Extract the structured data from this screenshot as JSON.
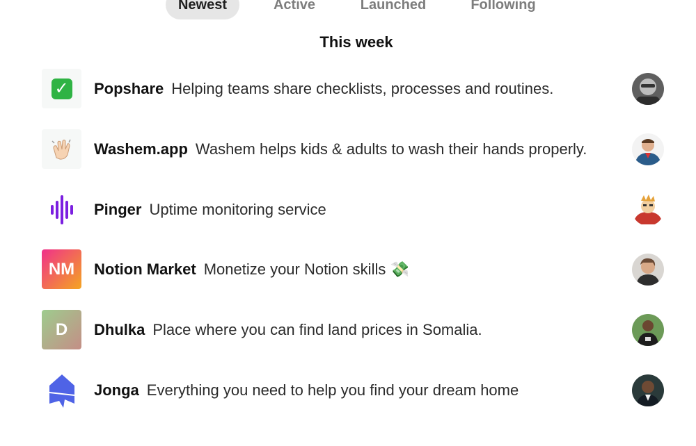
{
  "tabs": [
    {
      "label": "Newest",
      "active": true
    },
    {
      "label": "Active",
      "active": false
    },
    {
      "label": "Launched",
      "active": false
    },
    {
      "label": "Following",
      "active": false
    }
  ],
  "section": {
    "title": "This week"
  },
  "products": [
    {
      "name": "Popshare",
      "tagline": "Helping teams share checklists, processes and routines.",
      "icon": "checkmark-icon",
      "avatar_color": "#6f6f6f"
    },
    {
      "name": "Washem.app",
      "tagline": "Washem helps kids & adults to wash their hands properly.",
      "icon": "clapping-hands-icon",
      "avatar_color": "#2b5c8a"
    },
    {
      "name": "Pinger",
      "tagline": "Uptime monitoring service",
      "icon": "soundwave-icon",
      "avatar_color": "#c8382e"
    },
    {
      "name": "Notion Market",
      "tagline": "Monetize your Notion skills 💸",
      "icon": "nm-initials-icon",
      "icon_text": "NM",
      "avatar_color": "#7a6150"
    },
    {
      "name": "Dhulka",
      "tagline": "Place where you can find land prices in Somalia.",
      "icon": "d-initial-icon",
      "icon_text": "D",
      "avatar_color": "#4f7b48"
    },
    {
      "name": "Jonga",
      "tagline": "Everything you need to help you find your dream home",
      "icon": "house-icon",
      "avatar_color": "#2a3a3a"
    }
  ],
  "colors": {
    "tab_active_bg": "#e6e6e6",
    "pinger_purple": "#7b1fe0",
    "jonga_blue": "#4f63e6",
    "nm_gradient_start": "#f0318a",
    "nm_gradient_end": "#f4a521",
    "dhulka_gradient_start": "#9ecc8e",
    "dhulka_gradient_end": "#c48e86"
  }
}
